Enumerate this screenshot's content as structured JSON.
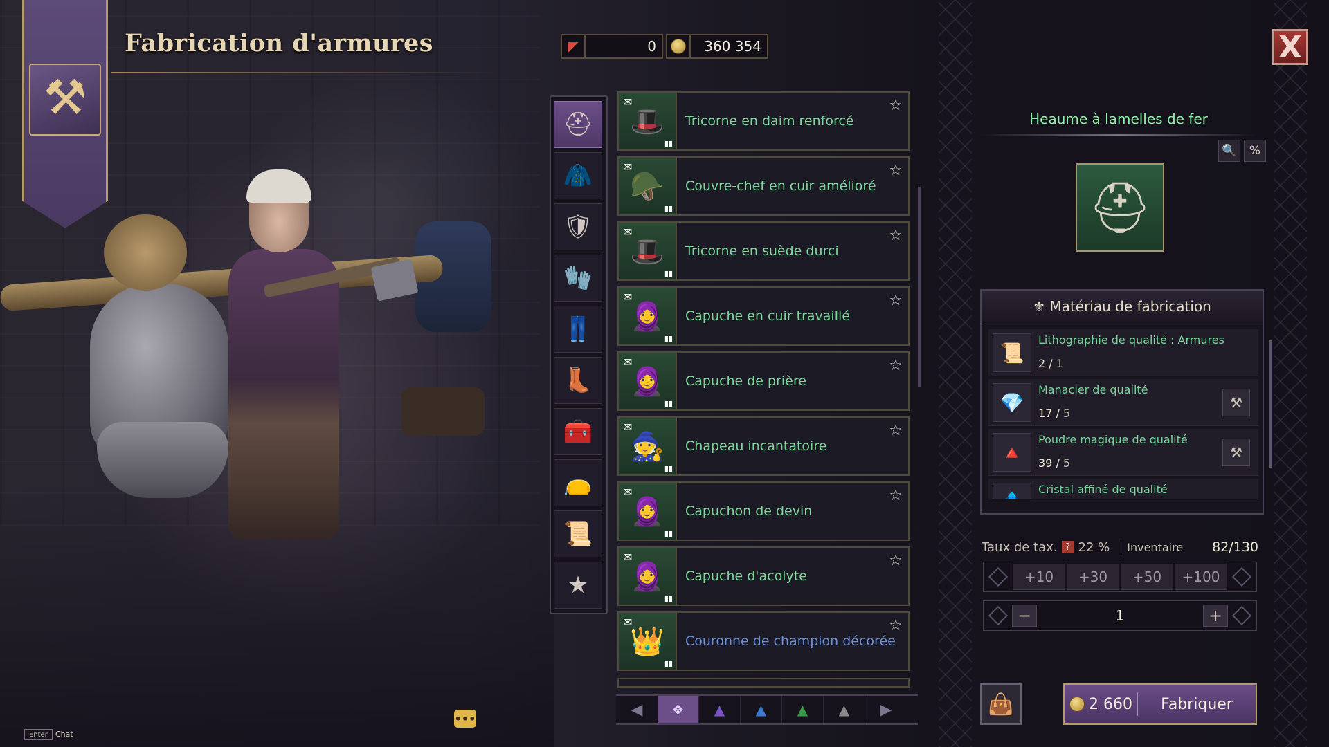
{
  "header": {
    "title": "Fabrication d'armures",
    "currency_red": "0",
    "currency_gold": "360 354",
    "close_glyph": "X"
  },
  "categories": [
    {
      "icon": "helmet-icon",
      "glyph": "⛑",
      "active": true
    },
    {
      "icon": "cloak-icon",
      "glyph": "🧥",
      "active": false
    },
    {
      "icon": "chest-armor-icon",
      "glyph": "🛡",
      "active": false
    },
    {
      "icon": "gloves-icon",
      "glyph": "🧤",
      "active": false
    },
    {
      "icon": "pants-icon",
      "glyph": "👖",
      "active": false
    },
    {
      "icon": "boots-icon",
      "glyph": "👢",
      "active": false
    },
    {
      "icon": "chest-box-icon",
      "glyph": "🧰",
      "active": false
    },
    {
      "icon": "pouch-icon",
      "glyph": "👝",
      "active": false
    },
    {
      "icon": "scroll-icon",
      "glyph": "📜",
      "active": false
    },
    {
      "icon": "favorite-star-icon",
      "glyph": "★",
      "active": false
    }
  ],
  "recipes": [
    {
      "name": "Tricorne en daim renforcé",
      "color": "green",
      "glyph": "🎩"
    },
    {
      "name": "Couvre-chef en cuir amélioré",
      "color": "green",
      "glyph": "🪖"
    },
    {
      "name": "Tricorne en suède durci",
      "color": "green",
      "glyph": "🎩"
    },
    {
      "name": "Capuche en cuir travaillé",
      "color": "green",
      "glyph": "🧕"
    },
    {
      "name": "Capuche de prière",
      "color": "green",
      "glyph": "🧕"
    },
    {
      "name": "Chapeau incantatoire",
      "color": "green",
      "glyph": "🧙"
    },
    {
      "name": "Capuchon de devin",
      "color": "green",
      "glyph": "🧕"
    },
    {
      "name": "Capuche d'acolyte",
      "color": "green",
      "glyph": "🧕"
    },
    {
      "name": "Couronne de champion décorée",
      "color": "blue",
      "glyph": "👑"
    }
  ],
  "grades": [
    "❖",
    "▲",
    "▲",
    "▲",
    "▲"
  ],
  "grade_colors": [
    "#e0d0ff",
    "#7a56c8",
    "#3a7ad0",
    "#3a9a4a",
    "#8a8a8a"
  ],
  "item": {
    "name": "Heaume à lamelles de fer",
    "glyph": "⛑",
    "search_glyph": "🔍",
    "percent_glyph": "%"
  },
  "materials": {
    "header": "⚜ Matériau de fabrication",
    "items": [
      {
        "name": "Lithographie de qualité : Armures",
        "have": "2",
        "need": "1",
        "glyph": "📜",
        "craftable": false
      },
      {
        "name": "Manacier de qualité",
        "have": "17",
        "need": "5",
        "glyph": "💎",
        "craftable": true
      },
      {
        "name": "Poudre magique de qualité",
        "have": "39",
        "need": "5",
        "glyph": "🔺",
        "craftable": true
      },
      {
        "name": "Cristal affiné de qualité",
        "have": "",
        "need": "",
        "glyph": "💠",
        "craftable": false
      }
    ]
  },
  "tax": {
    "label": "Taux de tax.",
    "value": "22 %",
    "inventory_label": "Inventaire",
    "inventory_value": "82/130"
  },
  "quantity": {
    "presets": [
      "+10",
      "+30",
      "+50",
      "+100"
    ],
    "value": "1"
  },
  "craft": {
    "cost": "2 660",
    "label": "Fabriquer"
  },
  "chat": {
    "key": "Enter",
    "label": "Chat"
  }
}
